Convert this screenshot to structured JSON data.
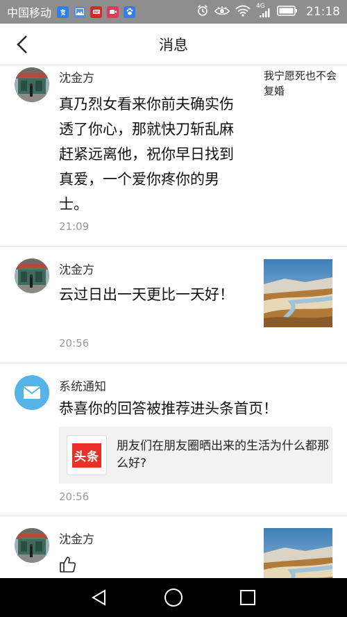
{
  "status_bar": {
    "carrier": "中国移动",
    "network": "4G",
    "time": "21:18",
    "app_icons": [
      {
        "name": "alipay-app-icon",
        "color": "#2f7fe8"
      },
      {
        "name": "gallery-app-icon",
        "color": "#5a8fd8"
      },
      {
        "name": "netease-news-app-icon",
        "color": "#d22b2b"
      },
      {
        "name": "video-app-icon",
        "color": "#e5395a"
      },
      {
        "name": "baidu-app-icon",
        "color": "#3c7be6"
      }
    ]
  },
  "header": {
    "title": "消息"
  },
  "messages": [
    {
      "name": "沈金方",
      "body": "真乃烈女看来你前夫确实伤透了你心，那就快刀斩乱麻赶紧远离他，祝你早日找到真爱，一个爱你疼你的男士。",
      "time": "21:09",
      "quote": "我宁愿死也不会复婚"
    },
    {
      "name": "沈金方",
      "body": "云过日出一天更比一天好！",
      "time": "20:56",
      "thumb": "landscape-thumbnail"
    },
    {
      "name": "系统通知",
      "body": "恭喜你的回答被推荐进头条首页！",
      "card_logo": "头条",
      "card_text": "朋友们在朋友圈晒出来的生活为什么都那么好?",
      "time": "20:56"
    },
    {
      "name": "沈金方",
      "thumb": "landscape-thumbnail"
    }
  ],
  "colors": {
    "status_bar": "#8e8e8e",
    "notice_avatar": "#56b3e8",
    "toutiao_red": "#e8302b"
  }
}
